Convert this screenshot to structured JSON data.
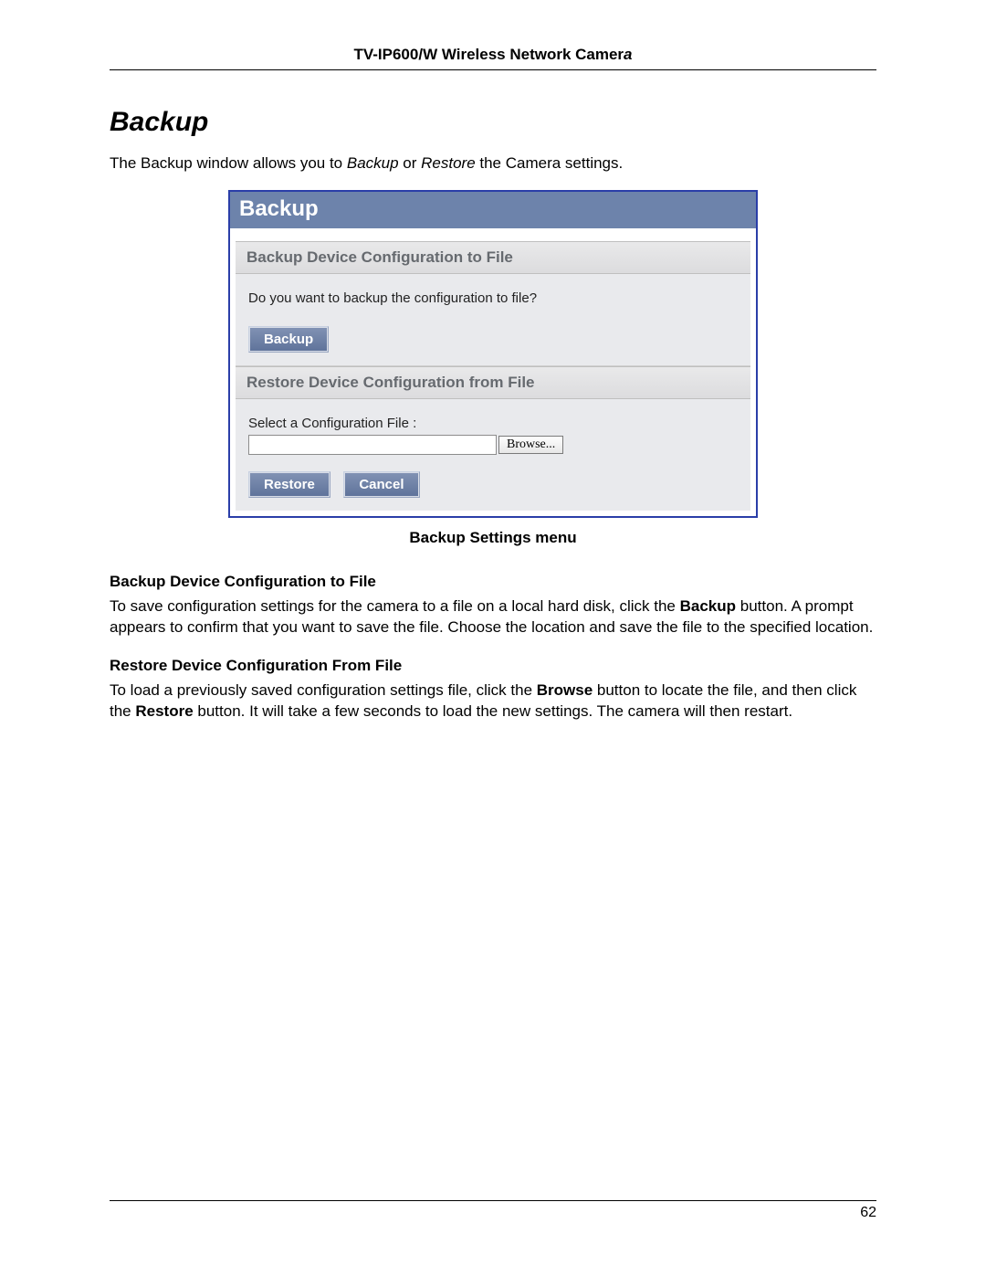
{
  "header": {
    "title_base": "TV-IP600/W Wireless Network Camer",
    "title_italic": "a"
  },
  "section": {
    "title": "Backup"
  },
  "intro": {
    "t1": "The Backup window allows you to ",
    "i1": "Backup",
    "t2": " or ",
    "i2": "Restore",
    "t3": " the Camera settings."
  },
  "shot": {
    "title": "Backup",
    "backup": {
      "header": "Backup Device Configuration to File",
      "question": "Do you want to backup the configuration to file?",
      "button": "Backup"
    },
    "restore": {
      "header": "Restore Device Configuration from File",
      "label": "Select a Configuration File :",
      "file_value": "",
      "browse": "Browse...",
      "restore_btn": "Restore",
      "cancel_btn": "Cancel"
    }
  },
  "caption": "Backup Settings menu",
  "sec1": {
    "h": "Backup Device Configuration to File",
    "p1": "To save configuration settings for the camera to a file on a local hard disk, click the ",
    "b1": "Backup",
    "p2": " button. A prompt appears to confirm that you want to save the file. Choose the location and save the file to the specified location."
  },
  "sec2": {
    "h": "Restore Device Configuration From File",
    "p1": "To load a previously saved configuration settings file, click the ",
    "b1": "Browse",
    "p2": " button to locate the file, and then click the ",
    "b2": "Restore",
    "p3": " button. It will take a few seconds to load the new settings. The camera will then restart."
  },
  "page_number": "62"
}
